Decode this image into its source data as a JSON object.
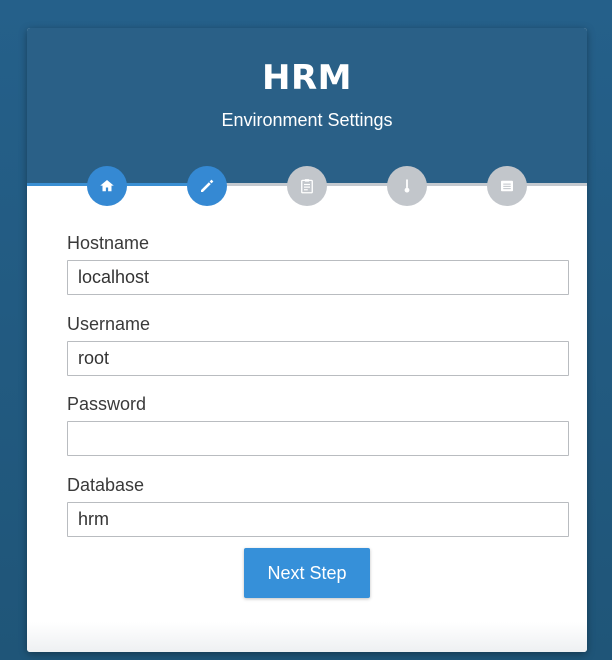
{
  "app": {
    "title": "HRM",
    "subtitle": "Environment Settings"
  },
  "steps": [
    {
      "icon": "home-icon",
      "state": "complete"
    },
    {
      "icon": "pencil-icon",
      "state": "active"
    },
    {
      "icon": "clipboard-icon",
      "state": "pending"
    },
    {
      "icon": "thermometer-icon",
      "state": "pending"
    },
    {
      "icon": "list-icon",
      "state": "pending"
    }
  ],
  "progress": {
    "current_step": 2,
    "total_steps": 5
  },
  "form": {
    "hostname": {
      "label": "Hostname",
      "value": "localhost",
      "placeholder": ""
    },
    "username": {
      "label": "Username",
      "value": "root",
      "placeholder": ""
    },
    "password": {
      "label": "Password",
      "value": "",
      "placeholder": ""
    },
    "database": {
      "label": "Database",
      "value": "hrm",
      "placeholder": ""
    }
  },
  "actions": {
    "next_label": "Next Step"
  },
  "colors": {
    "background": "#235a7f",
    "header": "#2a6087",
    "accent": "#3589d3",
    "inactive_step": "#c2c6cb"
  }
}
